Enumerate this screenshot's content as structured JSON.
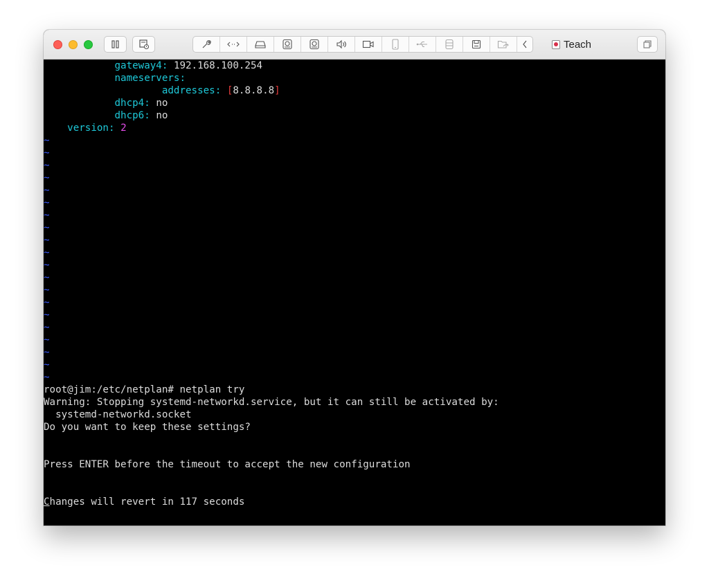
{
  "window": {
    "title": "Teach"
  },
  "toolbar": {
    "icons": [
      "pause-icon",
      "snapshot-icon",
      "wrench-icon",
      "code-arrows-icon",
      "hard-drive-icon",
      "camera-icon",
      "camera-alt-icon",
      "speaker-icon",
      "video-icon",
      "phone-icon",
      "usb-icon",
      "storage-icon",
      "save-icon",
      "folder-share-icon",
      "chevron-left-icon",
      "window-restore-icon"
    ]
  },
  "editor": {
    "gateway_key": "gateway4",
    "gateway_value": "192.168.100.254",
    "nameservers_key": "nameservers",
    "addresses_key": "addresses",
    "addresses_value": "8.8.8.8",
    "dhcp4_key": "dhcp4",
    "dhcp4_value": "no",
    "dhcp6_key": "dhcp6",
    "dhcp6_value": "no",
    "version_key": "version",
    "version_value": "2",
    "tilde": "~"
  },
  "console": {
    "prompt_line": "root@jim:/etc/netplan# netplan try",
    "warning_line": "Warning: Stopping systemd-networkd.service, but it can still be activated by:",
    "socket_line": "  systemd-networkd.socket",
    "question_line": "Do you want to keep these settings?",
    "press_line": "Press ENTER before the timeout to accept the new configuration",
    "cursor_char": "C",
    "revert_line_rest": "hanges will revert in 117 seconds"
  },
  "colors": {
    "key": "#1ec8d8",
    "number": "#e34ce8",
    "bracket": "#e33c3c",
    "tilde": "#3b5cff",
    "text": "#dcdcdc",
    "background": "#000000"
  }
}
